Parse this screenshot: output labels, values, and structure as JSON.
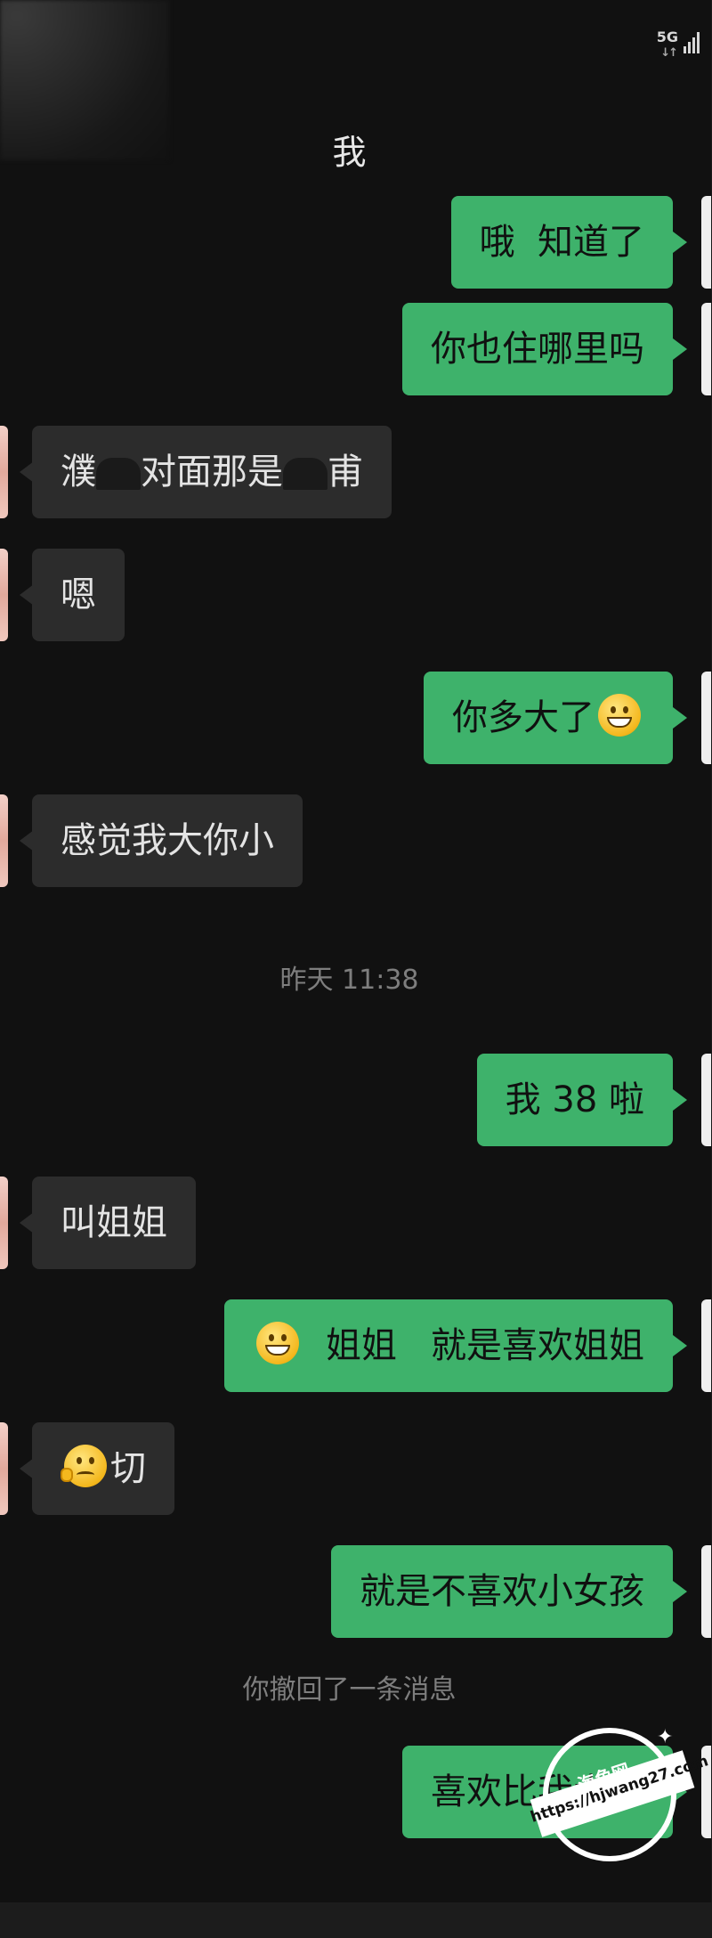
{
  "status_bar": {
    "network": "5G",
    "arrows": "↓↑"
  },
  "header": {
    "title": "我"
  },
  "messages": [
    {
      "side": "me",
      "parts": [
        {
          "text": "哦  知道了"
        }
      ]
    },
    {
      "side": "me",
      "parts": [
        {
          "text": "你也住哪里吗"
        }
      ]
    },
    {
      "side": "them",
      "parts": [
        {
          "text": "濮"
        },
        {
          "redact": true
        },
        {
          "text": "对面那是"
        },
        {
          "redact": true
        },
        {
          "text": "甫"
        }
      ]
    },
    {
      "side": "them",
      "parts": [
        {
          "text": "嗯"
        }
      ]
    },
    {
      "side": "me",
      "parts": [
        {
          "text": "你多大了"
        },
        {
          "emoji": "grin"
        }
      ]
    },
    {
      "side": "them",
      "parts": [
        {
          "text": "感觉我大你小"
        }
      ]
    },
    {
      "kind": "time",
      "text": "昨天 11:38"
    },
    {
      "side": "me",
      "parts": [
        {
          "text": "我 38 啦"
        }
      ]
    },
    {
      "side": "them",
      "parts": [
        {
          "text": "叫姐姐"
        }
      ]
    },
    {
      "side": "me",
      "parts": [
        {
          "emoji": "grin"
        },
        {
          "text": "  姐姐   就是喜欢姐姐"
        }
      ]
    },
    {
      "side": "them",
      "parts": [
        {
          "emoji": "confused"
        },
        {
          "text": "切"
        }
      ]
    },
    {
      "side": "me",
      "parts": [
        {
          "text": "就是不喜欢小女孩"
        }
      ]
    },
    {
      "kind": "system",
      "text": "你撤回了一条消息"
    },
    {
      "side": "me",
      "parts": [
        {
          "text": "喜欢比我大的"
        }
      ]
    }
  ],
  "watermark": {
    "name": "海角网",
    "url": "https://hjwang27.com"
  },
  "colors": {
    "background": "#111111",
    "me_bubble": "#3eb26b",
    "them_bubble": "#2c2c2c"
  }
}
